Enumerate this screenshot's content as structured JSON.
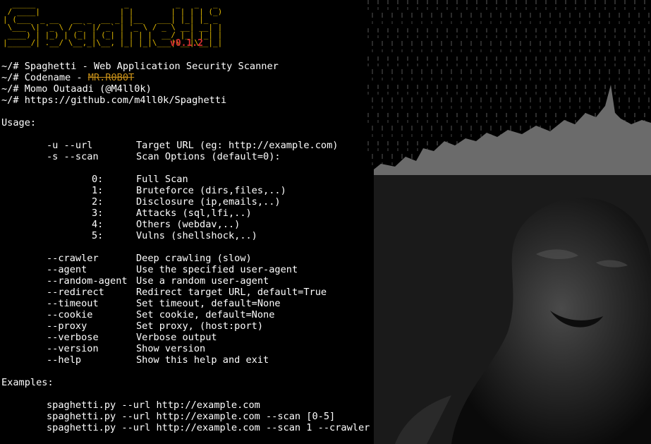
{
  "banner": {
    "art": [
      "  _____                   _          _   _   _",
      " / ____|                 | |        | | | | (_)",
      "| (___  _ __   __ _  __ _| |__   ___| |_| |_ _",
      " \\___ \\| '_ \\ / _` |/ _` | '_ \\ / _ \\ __| __| |",
      " ____) | |_) | (_| | (_| | | | |  __/ |_| |_| |",
      "|_____/| .__/ \\__,_|\\__, |_| |_|\\___|\\__|\\__|_|"
    ],
    "version": "v0.1.2"
  },
  "info": {
    "line1": "~/# Spaghetti - Web Application Security Scanner",
    "line2_prefix": "~/# Codename - ",
    "codename": "MR.R0B0T",
    "line3": "~/# Momo Outaadi (@M4ll0k)",
    "line4": "~/# https://github.com/m4ll0k/Spaghetti"
  },
  "usage_title": "Usage:",
  "opt_url": {
    "flag": "-u --url",
    "desc": "Target URL (eg: http://example.com)"
  },
  "opt_scan": {
    "flag": "-s --scan",
    "desc": "Scan Options (default=0):"
  },
  "scan_options": [
    {
      "num": "0:",
      "desc": "Full Scan"
    },
    {
      "num": "1:",
      "desc": "Bruteforce (dirs,files,..)"
    },
    {
      "num": "2:",
      "desc": "Disclosure (ip,emails,..)"
    },
    {
      "num": "3:",
      "desc": "Attacks (sql,lfi,..)"
    },
    {
      "num": "4:",
      "desc": "Others (webdav,..)"
    },
    {
      "num": "5:",
      "desc": "Vulns (shellshock,..)"
    }
  ],
  "options": [
    {
      "flag": "--crawler",
      "desc": "Deep crawling (slow)"
    },
    {
      "flag": "--agent",
      "desc": "Use the specified user-agent"
    },
    {
      "flag": "--random-agent",
      "desc": "Use a random user-agent"
    },
    {
      "flag": "--redirect",
      "desc": "Redirect target URL, default=True"
    },
    {
      "flag": "--timeout",
      "desc": "Set timeout, default=None"
    },
    {
      "flag": "--cookie",
      "desc": "Set cookie, default=None"
    },
    {
      "flag": "--proxy",
      "desc": "Set proxy, (host:port)"
    },
    {
      "flag": "--verbose",
      "desc": "Verbose output"
    },
    {
      "flag": "--version",
      "desc": "Show version"
    },
    {
      "flag": "--help",
      "desc": "Show this help and exit"
    }
  ],
  "examples_title": "Examples:",
  "examples": [
    "spaghetti.py --url http://example.com",
    "spaghetti.py --url http://example.com --scan [0-5]",
    "spaghetti.py --url http://example.com --scan 1 --crawler"
  ],
  "colors": {
    "background": "#000000",
    "text": "#ffffff",
    "banner": "#e0b800",
    "version": "#d53030",
    "codename": "#c89018"
  }
}
